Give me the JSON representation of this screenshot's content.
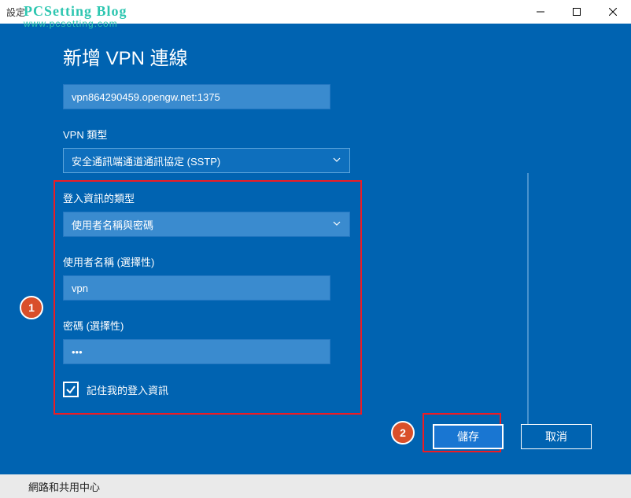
{
  "watermark": {
    "title": "PCSetting Blog",
    "url": "www.pcsetting.com"
  },
  "titlebar": {
    "title": "設定"
  },
  "page": {
    "title": "新增 VPN 連線"
  },
  "fields": {
    "server": {
      "value": "vpn864290459.opengw.net:1375"
    },
    "vpn_type": {
      "label": "VPN 類型",
      "value": "安全通訊端通道通訊協定 (SSTP)"
    },
    "signin_type": {
      "label": "登入資訊的類型",
      "value": "使用者名稱與密碼"
    },
    "username": {
      "label": "使用者名稱 (選擇性)",
      "value": "vpn"
    },
    "password": {
      "label": "密碼 (選擇性)",
      "value": "•••"
    },
    "remember": {
      "label": "記住我的登入資訊",
      "checked": true
    }
  },
  "buttons": {
    "save": "儲存",
    "cancel": "取消"
  },
  "annotations": {
    "badge1": "1",
    "badge2": "2"
  },
  "footer": {
    "text": "網路和共用中心"
  }
}
